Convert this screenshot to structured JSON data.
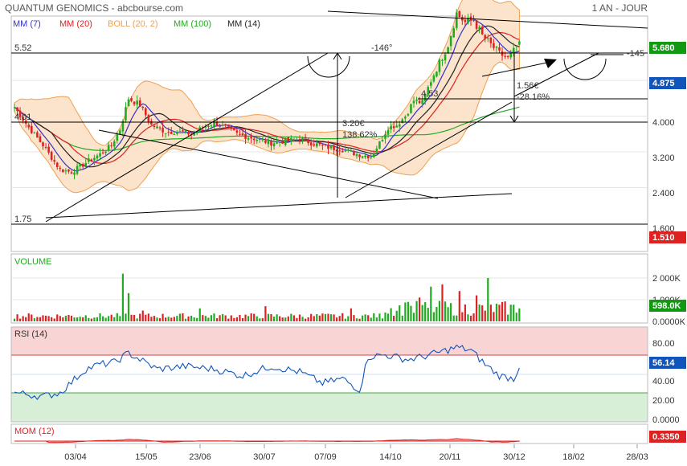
{
  "header": {
    "title": "QUANTUM GENOMICS - abcbourse.com",
    "period": "1 AN - JOUR"
  },
  "legend": [
    {
      "label": "MM (7)",
      "color": "#3333cc"
    },
    {
      "label": "MM (20)",
      "color": "#dd2222"
    },
    {
      "label": "BOLL (20, 2)",
      "color": "#f0a050"
    },
    {
      "label": "MM (100)",
      "color": "#22aa22"
    },
    {
      "label": "MM (14)",
      "color": "#222222"
    }
  ],
  "colors": {
    "up": "#22aa22",
    "down": "#dd2222",
    "badge_green": "#119911",
    "badge_blue": "#1155bb",
    "badge_red": "#dd2222",
    "boll_fill": "#fbe3cc",
    "rsi_high": "#f8d4d4",
    "rsi_low": "#d6efd6"
  },
  "x_axis": {
    "labels": [
      "03/04",
      "15/05",
      "23/06",
      "30/07",
      "07/09",
      "14/10",
      "20/11",
      "30/12",
      "18/02",
      "28/03"
    ]
  },
  "price_panel": {
    "y_ticks": [
      "4.000",
      "3.200",
      "2.400",
      "1.600"
    ],
    "ylim": [
      1.4,
      6.1
    ],
    "badges": [
      {
        "value": "5.680",
        "price": 5.68,
        "color": "#119911"
      },
      {
        "value": "4.875",
        "price": 4.875,
        "color": "#1155bb"
      },
      {
        "value": "1.510",
        "price": 1.51,
        "color": "#dd2222"
      }
    ],
    "annotations": {
      "level_high": "5.52",
      "level_mid": "4.01",
      "level_low": "1.75",
      "level_453": "4.53",
      "angle1": "-146°",
      "angle2": "-145",
      "gain_abs": "3.20€",
      "gain_pct": "138.62%",
      "small_abs": "1.56€",
      "small_pct": "-28.16%"
    }
  },
  "volume_panel": {
    "title": "VOLUME",
    "y_ticks": [
      "2 000K",
      "1 000K",
      "0.0000K"
    ],
    "badge": "598.0K"
  },
  "rsi_panel": {
    "title": "RSI (14)",
    "y_ticks": [
      "80.00",
      "60.00",
      "40.00",
      "20.00",
      "0.0000"
    ],
    "badge": "56.14"
  },
  "mom_panel": {
    "title": "MOM (12)",
    "badge": "0.3350"
  },
  "chart_data": {
    "type": "candlestick",
    "symbol": "QUANTUM GENOMICS",
    "period": "1 AN - JOUR",
    "price_range": [
      1.4,
      6.1
    ],
    "last_close": 4.875,
    "period_high": 5.68,
    "period_low": 1.51,
    "price_anchors": [
      {
        "index": 0,
        "close": 3.4
      },
      {
        "index": 5,
        "close": 2.95
      },
      {
        "index": 10,
        "close": 2.55
      },
      {
        "index": 16,
        "close": 2.0
      },
      {
        "index": 20,
        "close": 1.95
      },
      {
        "index": 26,
        "close": 2.2
      },
      {
        "index": 30,
        "close": 2.35
      },
      {
        "index": 34,
        "close": 2.55
      },
      {
        "index": 37,
        "close": 2.9
      },
      {
        "index": 40,
        "close": 3.6
      },
      {
        "index": 44,
        "close": 3.45
      },
      {
        "index": 48,
        "close": 3.0
      },
      {
        "index": 53,
        "close": 2.85
      },
      {
        "index": 58,
        "close": 2.85
      },
      {
        "index": 62,
        "close": 2.8
      },
      {
        "index": 66,
        "close": 2.95
      },
      {
        "index": 70,
        "close": 3.05
      },
      {
        "index": 74,
        "close": 2.95
      },
      {
        "index": 78,
        "close": 2.8
      },
      {
        "index": 84,
        "close": 2.7
      },
      {
        "index": 90,
        "close": 2.6
      },
      {
        "index": 96,
        "close": 2.65
      },
      {
        "index": 100,
        "close": 2.7
      },
      {
        "index": 104,
        "close": 2.6
      },
      {
        "index": 110,
        "close": 2.5
      },
      {
        "index": 115,
        "close": 2.45
      },
      {
        "index": 120,
        "close": 2.35
      },
      {
        "index": 125,
        "close": 2.3
      },
      {
        "index": 128,
        "close": 2.6
      },
      {
        "index": 131,
        "close": 2.95
      },
      {
        "index": 134,
        "close": 3.0
      },
      {
        "index": 137,
        "close": 3.2
      },
      {
        "index": 140,
        "close": 3.55
      },
      {
        "index": 143,
        "close": 3.5
      },
      {
        "index": 146,
        "close": 4.0
      },
      {
        "index": 149,
        "close": 4.4
      },
      {
        "index": 152,
        "close": 4.8
      },
      {
        "index": 155,
        "close": 5.5
      },
      {
        "index": 158,
        "close": 5.3
      },
      {
        "index": 161,
        "close": 5.35
      },
      {
        "index": 164,
        "close": 5.0
      },
      {
        "index": 167,
        "close": 4.8
      },
      {
        "index": 170,
        "close": 4.6
      },
      {
        "index": 173,
        "close": 4.5
      },
      {
        "index": 175,
        "close": 4.65
      },
      {
        "index": 177,
        "close": 4.875
      }
    ],
    "volume_range_k": [
      0,
      2600
    ],
    "volume_spikes_k": [
      {
        "index": 38,
        "volume": 2200
      },
      {
        "index": 40,
        "volume": 1300
      },
      {
        "index": 45,
        "volume": 500
      },
      {
        "index": 65,
        "volume": 600
      },
      {
        "index": 88,
        "volume": 700
      },
      {
        "index": 118,
        "volume": 600
      },
      {
        "index": 138,
        "volume": 900
      },
      {
        "index": 142,
        "volume": 1100
      },
      {
        "index": 146,
        "volume": 1600
      },
      {
        "index": 150,
        "volume": 1700
      },
      {
        "index": 156,
        "volume": 1400
      },
      {
        "index": 162,
        "volume": 1200
      },
      {
        "index": 166,
        "volume": 2000
      },
      {
        "index": 177,
        "volume": 598
      }
    ],
    "rsi_anchors": [
      {
        "index": 0,
        "rsi": 30
      },
      {
        "index": 10,
        "rsi": 26
      },
      {
        "index": 16,
        "rsi": 30
      },
      {
        "index": 25,
        "rsi": 55
      },
      {
        "index": 30,
        "rsi": 60
      },
      {
        "index": 35,
        "rsi": 62
      },
      {
        "index": 40,
        "rsi": 72
      },
      {
        "index": 50,
        "rsi": 55
      },
      {
        "index": 60,
        "rsi": 58
      },
      {
        "index": 70,
        "rsi": 55
      },
      {
        "index": 80,
        "rsi": 48
      },
      {
        "index": 90,
        "rsi": 58
      },
      {
        "index": 100,
        "rsi": 52
      },
      {
        "index": 108,
        "rsi": 40
      },
      {
        "index": 115,
        "rsi": 45
      },
      {
        "index": 121,
        "rsi": 33
      },
      {
        "index": 124,
        "rsi": 68
      },
      {
        "index": 130,
        "rsi": 70
      },
      {
        "index": 138,
        "rsi": 65
      },
      {
        "index": 143,
        "rsi": 68
      },
      {
        "index": 148,
        "rsi": 72
      },
      {
        "index": 155,
        "rsi": 78
      },
      {
        "index": 160,
        "rsi": 75
      },
      {
        "index": 165,
        "rsi": 60
      },
      {
        "index": 170,
        "rsi": 48
      },
      {
        "index": 175,
        "rsi": 45
      },
      {
        "index": 177,
        "rsi": 56.14
      }
    ],
    "rsi_bands": {
      "high": 70,
      "low": 30
    },
    "mom_last": 0.335
  }
}
